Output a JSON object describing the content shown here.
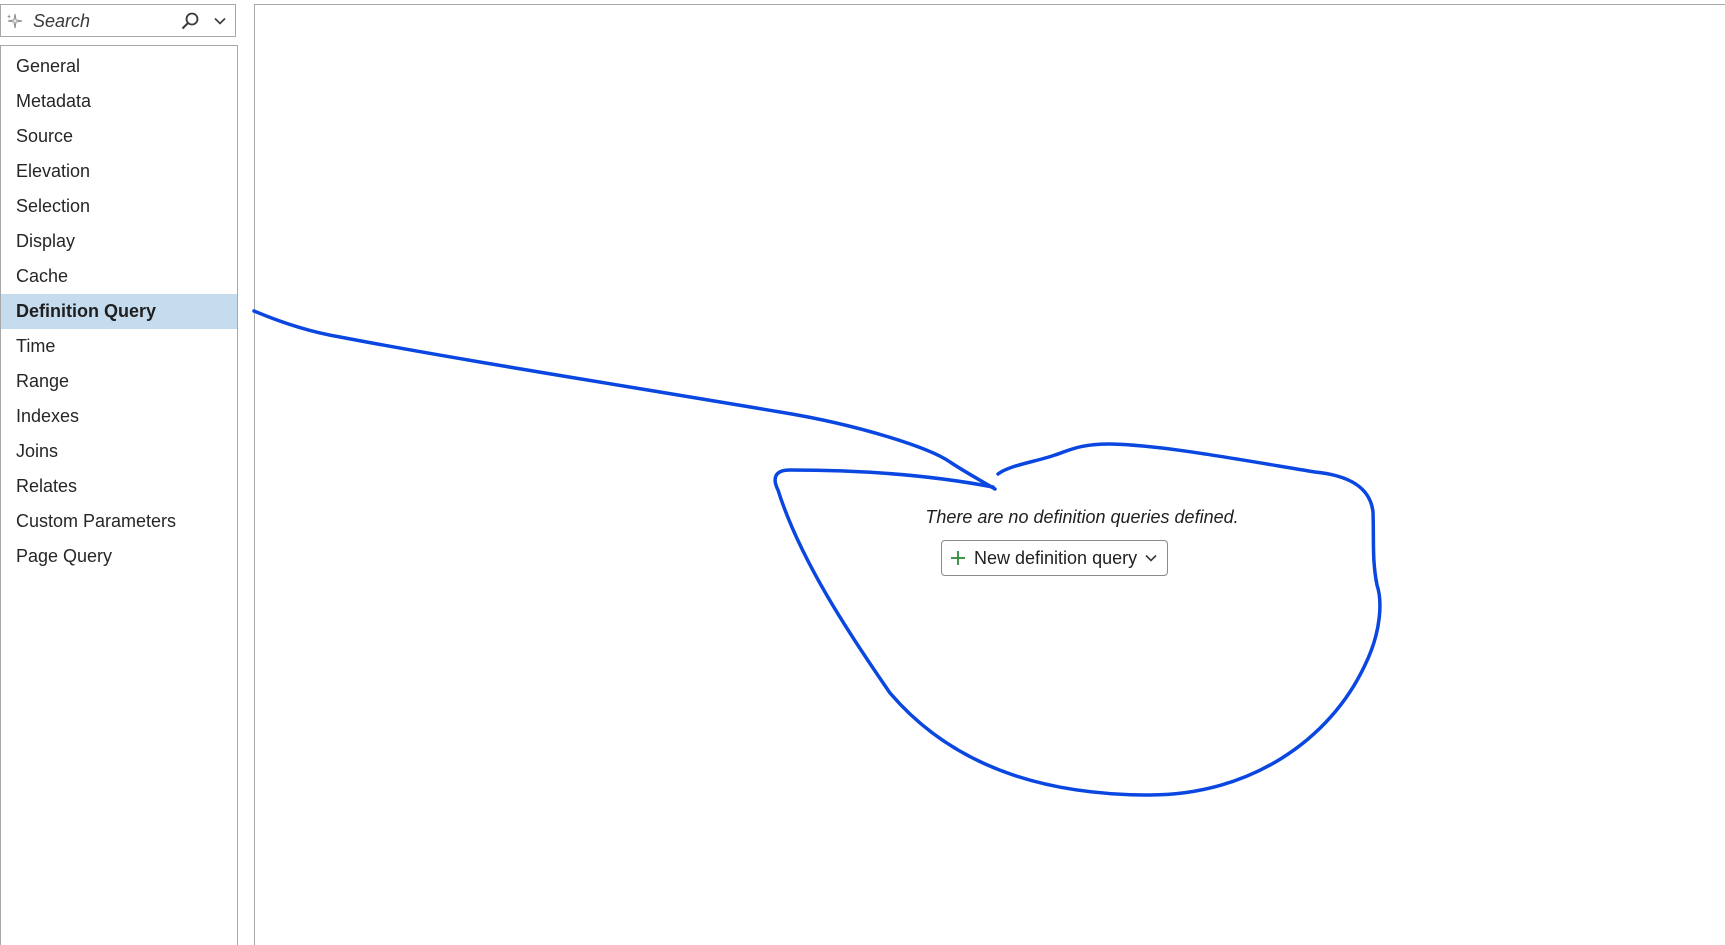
{
  "search": {
    "placeholder": "Search",
    "icon_left": "sparkle-icon",
    "icon_search": "search-icon",
    "icon_dropdown": "chevron-down-icon"
  },
  "sidebar": {
    "items": [
      {
        "label": "General",
        "selected": false
      },
      {
        "label": "Metadata",
        "selected": false
      },
      {
        "label": "Source",
        "selected": false
      },
      {
        "label": "Elevation",
        "selected": false
      },
      {
        "label": "Selection",
        "selected": false
      },
      {
        "label": "Display",
        "selected": false
      },
      {
        "label": "Cache",
        "selected": false
      },
      {
        "label": "Definition Query",
        "selected": true
      },
      {
        "label": "Time",
        "selected": false
      },
      {
        "label": "Range",
        "selected": false
      },
      {
        "label": "Indexes",
        "selected": false
      },
      {
        "label": "Joins",
        "selected": false
      },
      {
        "label": "Relates",
        "selected": false
      },
      {
        "label": "Custom Parameters",
        "selected": false
      },
      {
        "label": "Page Query",
        "selected": false
      }
    ],
    "selected_color": "#c5dcef"
  },
  "main": {
    "empty_message": "There are no definition queries defined.",
    "new_query_button": {
      "label": "New definition query",
      "icon": "plus-icon",
      "dropdown_icon": "chevron-down-icon"
    }
  },
  "colors": {
    "annotation_stroke": "#0a46e0",
    "plus_green": "#2e8b3a",
    "border": "#a8a8a8"
  }
}
